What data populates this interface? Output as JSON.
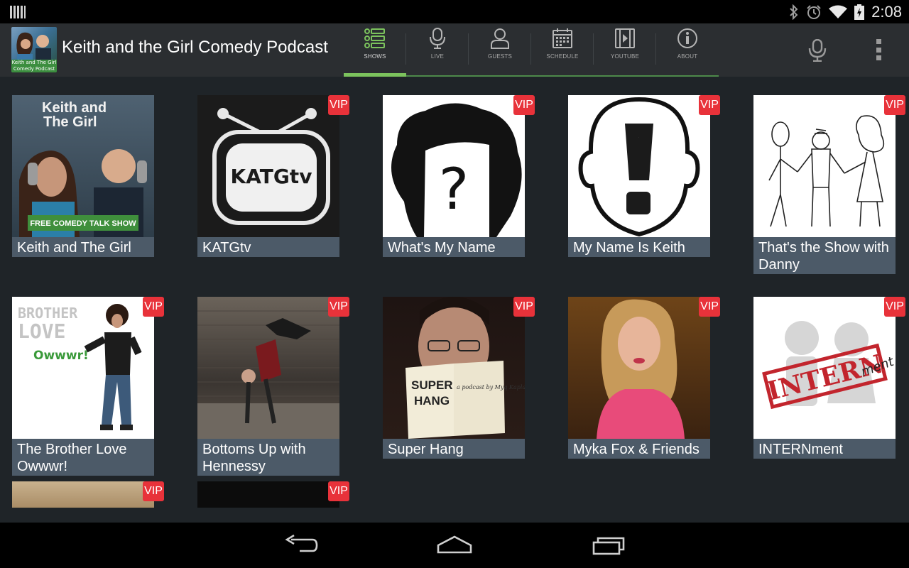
{
  "status_bar": {
    "time": "2:08",
    "icons": [
      "bluetooth-icon",
      "alarm-icon",
      "wifi-icon",
      "battery-icon"
    ]
  },
  "action_bar": {
    "app_title": "Keith and the Girl Comedy Podcast",
    "logo_text": "Keith and The Girl Comedy Podcast",
    "tabs": [
      {
        "label": "SHOWS",
        "icon": "list-icon",
        "active": true
      },
      {
        "label": "LIVE",
        "icon": "microphone-icon",
        "active": false
      },
      {
        "label": "GUESTS",
        "icon": "person-icon",
        "active": false
      },
      {
        "label": "SCHEDULE",
        "icon": "calendar-icon",
        "active": false
      },
      {
        "label": "YOUTUBE",
        "icon": "film-icon",
        "active": false
      },
      {
        "label": "ABOUT",
        "icon": "info-icon",
        "active": false
      }
    ],
    "actions": [
      "microphone-icon",
      "overflow-menu-icon"
    ]
  },
  "shows": [
    {
      "title": "Keith and The Girl",
      "vip": false,
      "art_text": [
        "Keith and",
        "The Girl",
        "FREE COMEDY TALK SHOW"
      ]
    },
    {
      "title": "KATGtv",
      "vip": true,
      "vip_label": "VIP",
      "art_text": [
        "KATGtv"
      ]
    },
    {
      "title": "What's My Name",
      "vip": true,
      "vip_label": "VIP",
      "art_text": [
        "?"
      ]
    },
    {
      "title": "My Name Is Keith",
      "vip": true,
      "vip_label": "VIP",
      "art_text": [
        "!"
      ]
    },
    {
      "title": "That's the Show with Danny",
      "vip": true,
      "vip_label": "VIP"
    },
    {
      "title": "The Brother Love Owwwr!",
      "vip": true,
      "vip_label": "VIP",
      "art_text": [
        "BROTHER",
        "LOVE",
        "Owwwr!"
      ]
    },
    {
      "title": "Bottoms Up with Hennessy",
      "vip": true,
      "vip_label": "VIP"
    },
    {
      "title": "Super Hang",
      "vip": true,
      "vip_label": "VIP",
      "art_text": [
        "SUPER",
        "HANG",
        "a podcast by Myq Kaplan"
      ]
    },
    {
      "title": "Myka Fox & Friends",
      "vip": true,
      "vip_label": "VIP"
    },
    {
      "title": "INTERNment",
      "vip": true,
      "vip_label": "VIP",
      "art_text": [
        "INTERN",
        "ment"
      ]
    },
    {
      "title": "",
      "vip": true,
      "vip_label": "VIP"
    },
    {
      "title": "",
      "vip": true,
      "vip_label": "VIP"
    }
  ],
  "nav_bar": {
    "buttons": [
      "back-icon",
      "home-icon",
      "recents-icon"
    ]
  }
}
